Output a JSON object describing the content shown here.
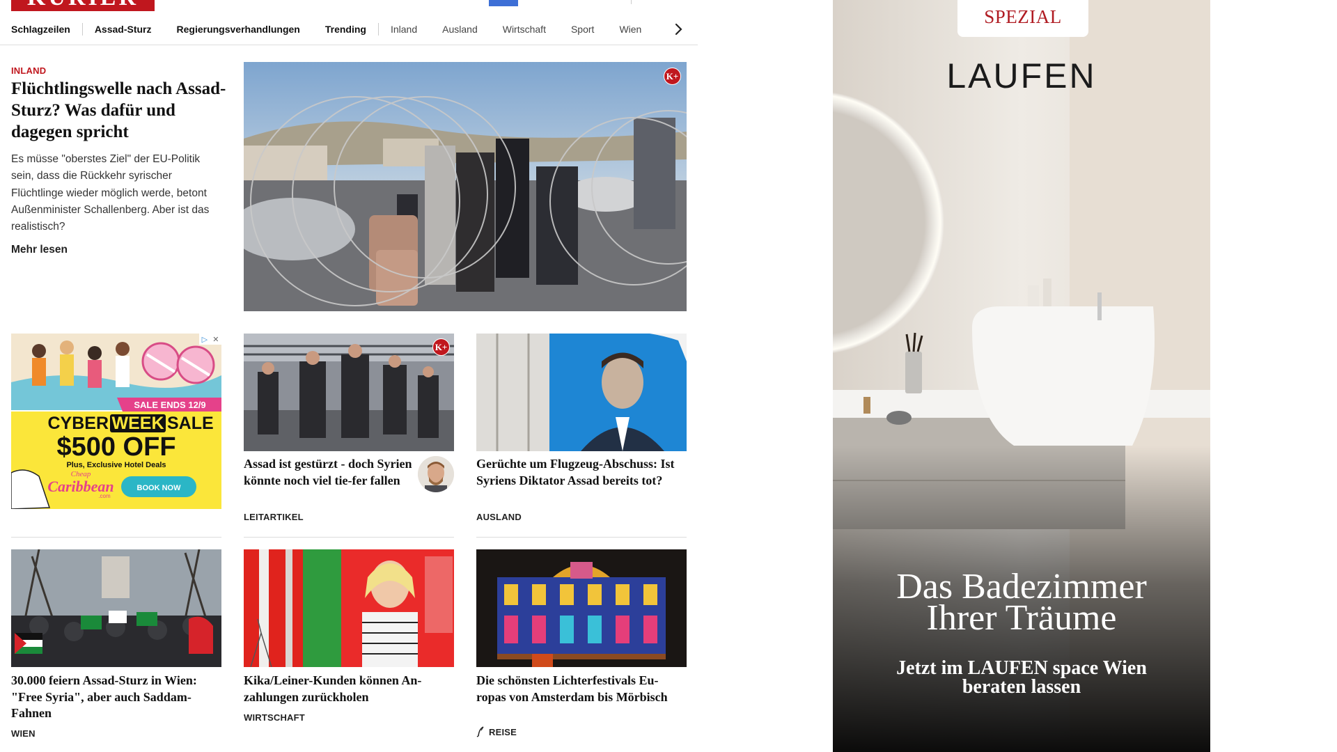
{
  "header": {
    "logo_text": "KURIER",
    "brand_color": "#c0171e"
  },
  "nav": {
    "items": [
      {
        "label": "Schlagzeilen"
      },
      {
        "label": "Assad-Sturz"
      },
      {
        "label": "Regierungsverhandlungen"
      },
      {
        "label": "Trending"
      },
      {
        "label": "Inland"
      },
      {
        "label": "Ausland"
      },
      {
        "label": "Wirtschaft"
      },
      {
        "label": "Sport"
      },
      {
        "label": "Wien"
      }
    ],
    "next_icon": "chevron-right-icon"
  },
  "lead": {
    "kicker": "INLAND",
    "title": "Flüchtlingswelle nach Assad-Sturz? Was dafür und dagegen spricht",
    "teaser": "Es müsse \"oberstes Ziel\" der EU-Politik sein, dass die Rückkehr syrischer Flüchtlinge wieder möglich werde, betont Außenminister Schallenberg. Aber ist das realistisch?",
    "more": "Mehr lesen",
    "badge": "K+"
  },
  "cards_row1": [
    {
      "title": "Assad ist gestürzt - doch Syrien könnte noch viel tie-fer fallen",
      "category": "LEITARTIKEL",
      "badge": "K+"
    },
    {
      "title": "Gerüchte um Flugzeug-Abschuss: Ist Syriens Diktator Assad bereits tot?",
      "category": "AUSLAND"
    }
  ],
  "cards_row2": [
    {
      "title": "30.000 feiern Assad-Sturz in Wien: \"Free Syria\", aber auch Saddam-Fahnen",
      "category": "WIEN"
    },
    {
      "title": "Kika/Leiner-Kunden können An-zahlungen zurückholen",
      "category": "WIRTSCHAFT"
    },
    {
      "title": "Die schönsten Lichterfestivals Eu-ropas von Amsterdam bis Mörbisch",
      "category": "REISE"
    }
  ],
  "ad_cyber": {
    "sale_ends": "SALE ENDS 12/9",
    "cyber": "CYBER",
    "week": "WEEK",
    "sale": "SALE",
    "amount": "$500 OFF",
    "sub": "Plus, Exclusive Hotel Deals",
    "brand_top": "Cheap",
    "brand_main": "Caribbean",
    "brand_suffix": ".com",
    "cta": "BOOK NOW"
  },
  "ad_laufen": {
    "tag": "SPEZIAL",
    "logo": "LAUFEN",
    "headline_line1": "Das Badezimmer",
    "headline_line2": "Ihrer Träume",
    "sub_line1": "Jetzt im LAUFEN space Wien",
    "sub_line2": "beraten lassen"
  }
}
